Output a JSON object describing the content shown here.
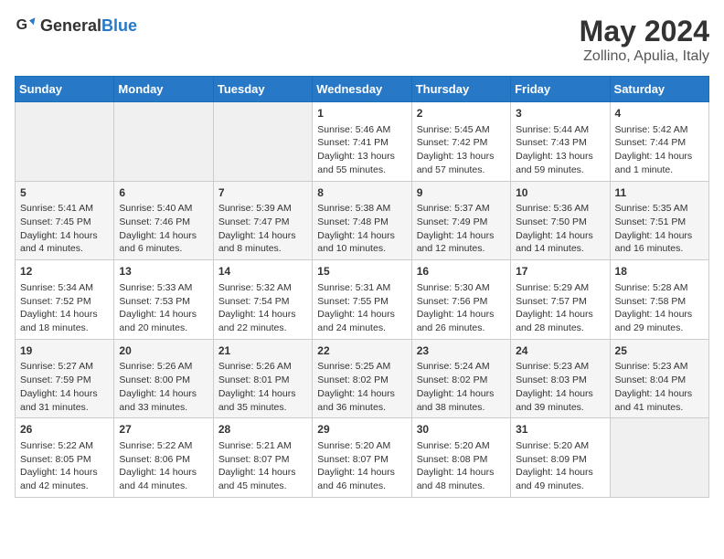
{
  "header": {
    "logo_general": "General",
    "logo_blue": "Blue",
    "month_title": "May 2024",
    "location": "Zollino, Apulia, Italy"
  },
  "days_of_week": [
    "Sunday",
    "Monday",
    "Tuesday",
    "Wednesday",
    "Thursday",
    "Friday",
    "Saturday"
  ],
  "weeks": [
    {
      "days": [
        {
          "number": "",
          "content": ""
        },
        {
          "number": "",
          "content": ""
        },
        {
          "number": "",
          "content": ""
        },
        {
          "number": "1",
          "content": "Sunrise: 5:46 AM\nSunset: 7:41 PM\nDaylight: 13 hours and 55 minutes."
        },
        {
          "number": "2",
          "content": "Sunrise: 5:45 AM\nSunset: 7:42 PM\nDaylight: 13 hours and 57 minutes."
        },
        {
          "number": "3",
          "content": "Sunrise: 5:44 AM\nSunset: 7:43 PM\nDaylight: 13 hours and 59 minutes."
        },
        {
          "number": "4",
          "content": "Sunrise: 5:42 AM\nSunset: 7:44 PM\nDaylight: 14 hours and 1 minute."
        }
      ]
    },
    {
      "days": [
        {
          "number": "5",
          "content": "Sunrise: 5:41 AM\nSunset: 7:45 PM\nDaylight: 14 hours and 4 minutes."
        },
        {
          "number": "6",
          "content": "Sunrise: 5:40 AM\nSunset: 7:46 PM\nDaylight: 14 hours and 6 minutes."
        },
        {
          "number": "7",
          "content": "Sunrise: 5:39 AM\nSunset: 7:47 PM\nDaylight: 14 hours and 8 minutes."
        },
        {
          "number": "8",
          "content": "Sunrise: 5:38 AM\nSunset: 7:48 PM\nDaylight: 14 hours and 10 minutes."
        },
        {
          "number": "9",
          "content": "Sunrise: 5:37 AM\nSunset: 7:49 PM\nDaylight: 14 hours and 12 minutes."
        },
        {
          "number": "10",
          "content": "Sunrise: 5:36 AM\nSunset: 7:50 PM\nDaylight: 14 hours and 14 minutes."
        },
        {
          "number": "11",
          "content": "Sunrise: 5:35 AM\nSunset: 7:51 PM\nDaylight: 14 hours and 16 minutes."
        }
      ]
    },
    {
      "days": [
        {
          "number": "12",
          "content": "Sunrise: 5:34 AM\nSunset: 7:52 PM\nDaylight: 14 hours and 18 minutes."
        },
        {
          "number": "13",
          "content": "Sunrise: 5:33 AM\nSunset: 7:53 PM\nDaylight: 14 hours and 20 minutes."
        },
        {
          "number": "14",
          "content": "Sunrise: 5:32 AM\nSunset: 7:54 PM\nDaylight: 14 hours and 22 minutes."
        },
        {
          "number": "15",
          "content": "Sunrise: 5:31 AM\nSunset: 7:55 PM\nDaylight: 14 hours and 24 minutes."
        },
        {
          "number": "16",
          "content": "Sunrise: 5:30 AM\nSunset: 7:56 PM\nDaylight: 14 hours and 26 minutes."
        },
        {
          "number": "17",
          "content": "Sunrise: 5:29 AM\nSunset: 7:57 PM\nDaylight: 14 hours and 28 minutes."
        },
        {
          "number": "18",
          "content": "Sunrise: 5:28 AM\nSunset: 7:58 PM\nDaylight: 14 hours and 29 minutes."
        }
      ]
    },
    {
      "days": [
        {
          "number": "19",
          "content": "Sunrise: 5:27 AM\nSunset: 7:59 PM\nDaylight: 14 hours and 31 minutes."
        },
        {
          "number": "20",
          "content": "Sunrise: 5:26 AM\nSunset: 8:00 PM\nDaylight: 14 hours and 33 minutes."
        },
        {
          "number": "21",
          "content": "Sunrise: 5:26 AM\nSunset: 8:01 PM\nDaylight: 14 hours and 35 minutes."
        },
        {
          "number": "22",
          "content": "Sunrise: 5:25 AM\nSunset: 8:02 PM\nDaylight: 14 hours and 36 minutes."
        },
        {
          "number": "23",
          "content": "Sunrise: 5:24 AM\nSunset: 8:02 PM\nDaylight: 14 hours and 38 minutes."
        },
        {
          "number": "24",
          "content": "Sunrise: 5:23 AM\nSunset: 8:03 PM\nDaylight: 14 hours and 39 minutes."
        },
        {
          "number": "25",
          "content": "Sunrise: 5:23 AM\nSunset: 8:04 PM\nDaylight: 14 hours and 41 minutes."
        }
      ]
    },
    {
      "days": [
        {
          "number": "26",
          "content": "Sunrise: 5:22 AM\nSunset: 8:05 PM\nDaylight: 14 hours and 42 minutes."
        },
        {
          "number": "27",
          "content": "Sunrise: 5:22 AM\nSunset: 8:06 PM\nDaylight: 14 hours and 44 minutes."
        },
        {
          "number": "28",
          "content": "Sunrise: 5:21 AM\nSunset: 8:07 PM\nDaylight: 14 hours and 45 minutes."
        },
        {
          "number": "29",
          "content": "Sunrise: 5:20 AM\nSunset: 8:07 PM\nDaylight: 14 hours and 46 minutes."
        },
        {
          "number": "30",
          "content": "Sunrise: 5:20 AM\nSunset: 8:08 PM\nDaylight: 14 hours and 48 minutes."
        },
        {
          "number": "31",
          "content": "Sunrise: 5:20 AM\nSunset: 8:09 PM\nDaylight: 14 hours and 49 minutes."
        },
        {
          "number": "",
          "content": ""
        }
      ]
    }
  ]
}
